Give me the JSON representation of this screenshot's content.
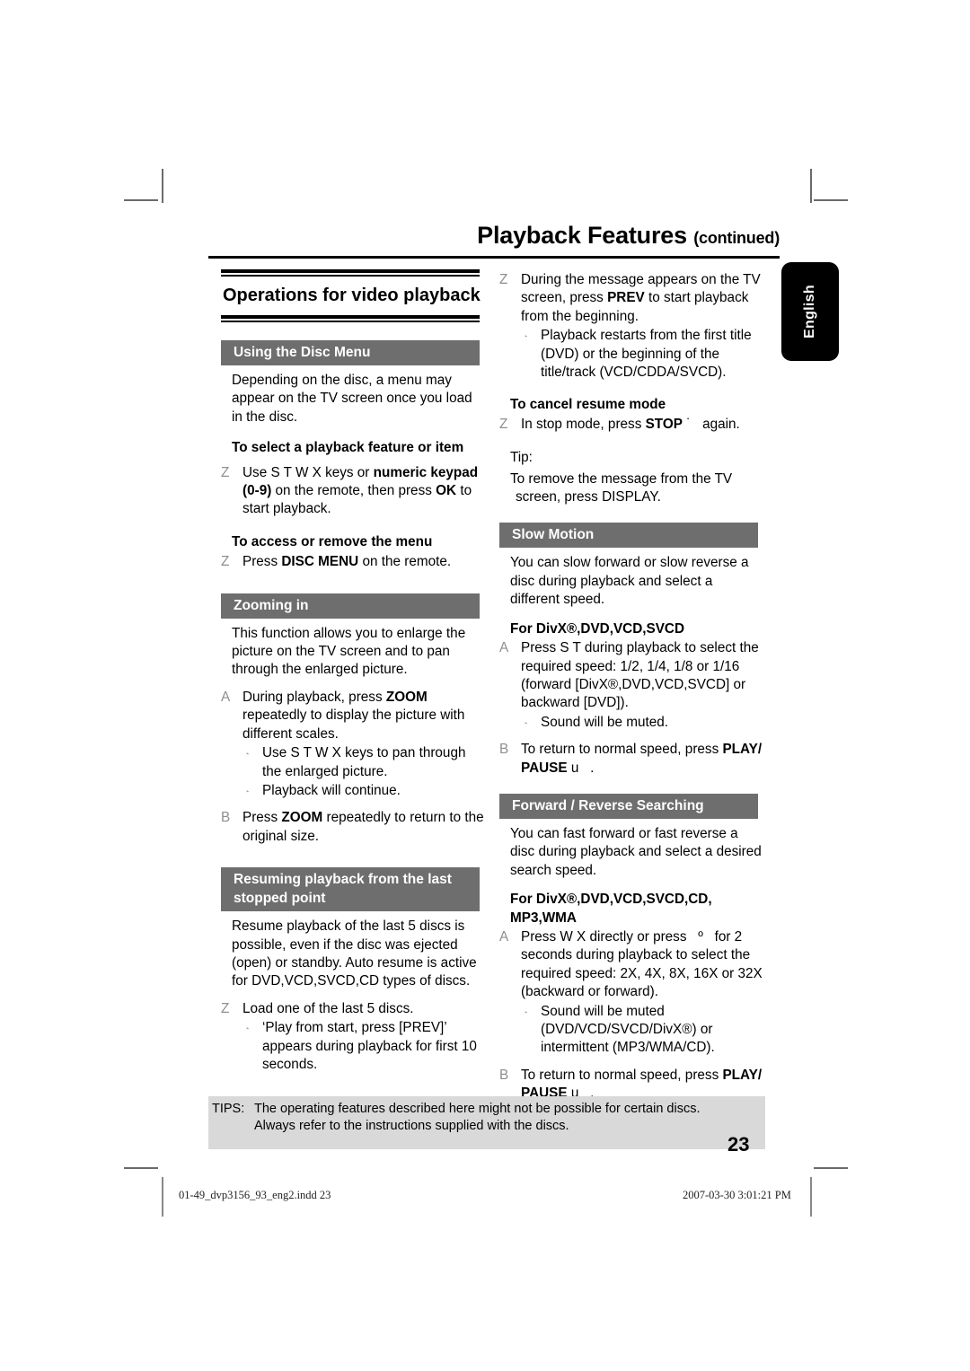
{
  "header": {
    "title": "Playback Features",
    "continued": "(continued)"
  },
  "language_tab": {
    "label": "English"
  },
  "left_column": {
    "big_heading": "Operations for video playback",
    "sections": [
      {
        "bar_title": "Using the Disc Menu",
        "intro": "Depending on the disc, a menu may appear on the TV screen once you load in the disc.",
        "sub1_title": "To select a playback feature or item",
        "sub1_marker": "Z",
        "sub1_text_a": "Use",
        "sub1_keys": "S  T  W X",
        "sub1_text_b": "keys or",
        "sub1_bold_a": "numeric keypad (0-9)",
        "sub1_text_c": "on the remote, then press",
        "sub1_bold_b": "OK",
        "sub1_text_d": "to start playback.",
        "sub2_title": "To access or remove the menu",
        "sub2_marker": "Z",
        "sub2_text_a": "Press",
        "sub2_bold_a": "DISC MENU",
        "sub2_text_b": "on the remote."
      },
      {
        "bar_title": "Zooming in",
        "intro": "This function allows you to enlarge the picture on the TV screen and to pan through the enlarged picture.",
        "step_a_marker": "A",
        "step_a_text_a": "During playback, press",
        "step_a_bold": "ZOOM",
        "step_a_text_b": "repeatedly to display the picture with different scales.",
        "bullet_1_a": "Use",
        "bullet_1_keys": "S  T  W X",
        "bullet_1_b": "keys to pan through the enlarged picture.",
        "bullet_2": "Playback will continue.",
        "step_b_marker": "B",
        "step_b_text_a": "Press",
        "step_b_bold": "ZOOM",
        "step_b_text_b": "repeatedly to return to the original size."
      },
      {
        "bar_title": "Resuming playback from the last stopped point",
        "intro": "Resume playback of the last 5 discs is possible, even if the disc was ejected (open) or standby. Auto resume is active for DVD,VCD,SVCD,CD types of discs.",
        "step_marker": "Z",
        "step_text": "Load one of the last 5 discs.",
        "bullet_1": "‘Play from start, press [PREV]’ appears during playback for first 10 seconds."
      }
    ]
  },
  "right_column": {
    "continued_step": {
      "marker": "Z",
      "text_a": "During the message appears on the TV screen, press",
      "bold": "PREV",
      "text_b": "to start playback from the beginning.",
      "bullet": "Playback restarts from the first title (DVD) or the beginning of the title/track (VCD/CDDA/SVCD)."
    },
    "cancel_resume": {
      "title": "To cancel resume mode",
      "marker": "Z",
      "text_a": "In stop mode, press",
      "bold": "STOP",
      "symbol": "˙",
      "text_b": "again."
    },
    "tip": {
      "label": "Tip:",
      "text": "To remove the message from the TV screen, press DISPLAY."
    },
    "sections": [
      {
        "bar_title": "Slow Motion",
        "intro": "You can slow forward or slow reverse a disc during playback and select a different speed.",
        "subhead": "For DivX®,DVD,VCD,SVCD",
        "step_a_marker": "A",
        "step_a_text_a": "Press",
        "step_a_keys": "S  T",
        "step_a_text_b": "during playback to select the required speed: 1/2, 1/4, 1/8 or 1/16 (forward [DivX®,DVD,VCD,SVCD] or backward [DVD]).",
        "bullet_1": "Sound will be muted.",
        "step_b_marker": "B",
        "step_b_text_a": "To return to normal speed, press",
        "step_b_bold": "PLAY/ PAUSE",
        "step_b_symbol": "u",
        "step_b_text_b": "."
      },
      {
        "bar_title": "Forward / Reverse Searching",
        "intro": "You can fast forward or fast reverse a disc during playback and select a desired search speed.",
        "subhead": "For DivX®,DVD,VCD,SVCD,CD, MP3,WMA",
        "step_a_marker": "A",
        "step_a_text_a": "Press",
        "step_a_keys": "W X",
        "step_a_text_b": "directly or press",
        "step_a_symbol": "º",
        "step_a_text_c": "for 2 seconds during playback to select the required speed: 2X, 4X, 8X, 16X or 32X (backward or forward).",
        "bullet_1": "Sound will be muted (DVD/VCD/SVCD/DivX®) or intermittent (MP3/WMA/CD).",
        "step_b_marker": "B",
        "step_b_text_a": "To return to normal speed, press",
        "step_b_bold": "PLAY/ PAUSE",
        "step_b_symbol": "u",
        "step_b_text_b": "."
      }
    ]
  },
  "tips_box": {
    "label": "TIPS:",
    "line1": "The operating features described here might not be possible for certain discs.",
    "line2": "Always refer to the instructions supplied with the discs."
  },
  "page_number": "23",
  "footer": {
    "left": "01-49_dvp3156_93_eng2.indd   23",
    "right": "2007-03-30   3:01:21 PM"
  }
}
